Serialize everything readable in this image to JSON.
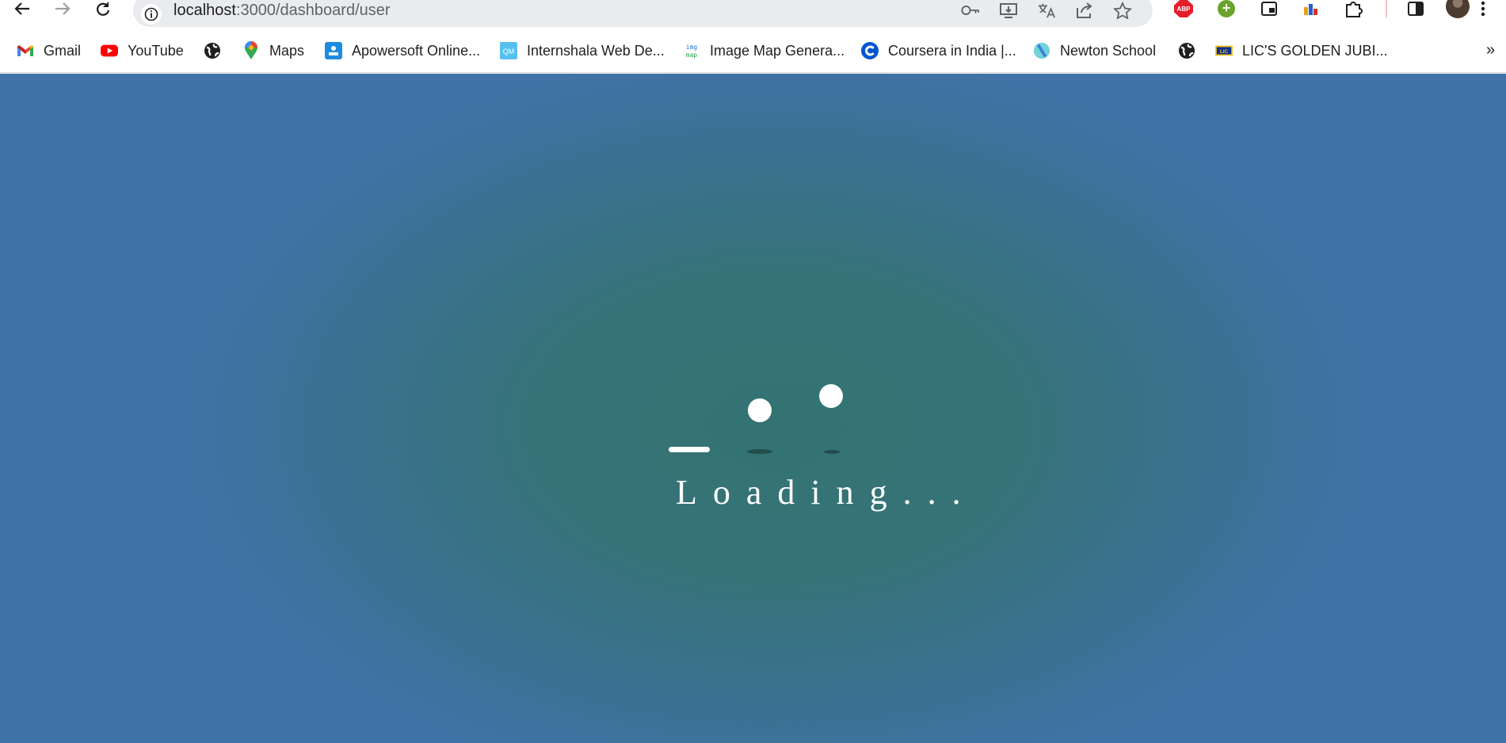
{
  "browser": {
    "url_host": "localhost",
    "url_rest": ":3000/dashboard/user",
    "nav_icons": [
      "back-arrow-icon",
      "forward-arrow-icon",
      "reload-icon"
    ],
    "omnibox_icons": [
      "key-icon",
      "install-app-icon",
      "translate-icon",
      "share-icon",
      "star-icon"
    ],
    "extensions": {
      "abp_label": "ABP",
      "plus_label": "+"
    }
  },
  "bookmarks": {
    "items": [
      {
        "label": "Gmail",
        "icon": "gmail-icon"
      },
      {
        "label": "YouTube",
        "icon": "youtube-icon"
      },
      {
        "label": "",
        "icon": "globe-icon"
      },
      {
        "label": "Maps",
        "icon": "maps-icon"
      },
      {
        "label": "Apowersoft Online...",
        "icon": "apowersoft-icon"
      },
      {
        "label": "Internshala Web De...",
        "icon": "internshala-icon"
      },
      {
        "label": "Image Map Genera...",
        "icon": "imgmap-icon"
      },
      {
        "label": "Coursera in India |...",
        "icon": "coursera-icon"
      },
      {
        "label": "Newton School",
        "icon": "newton-icon"
      },
      {
        "label": "",
        "icon": "globe-icon"
      },
      {
        "label": "LIC'S GOLDEN JUBI...",
        "icon": "lic-icon"
      }
    ],
    "more_label": "»"
  },
  "page": {
    "loading_text": "Loading...",
    "background_center": "#347372",
    "background_edge": "#4173a8"
  }
}
